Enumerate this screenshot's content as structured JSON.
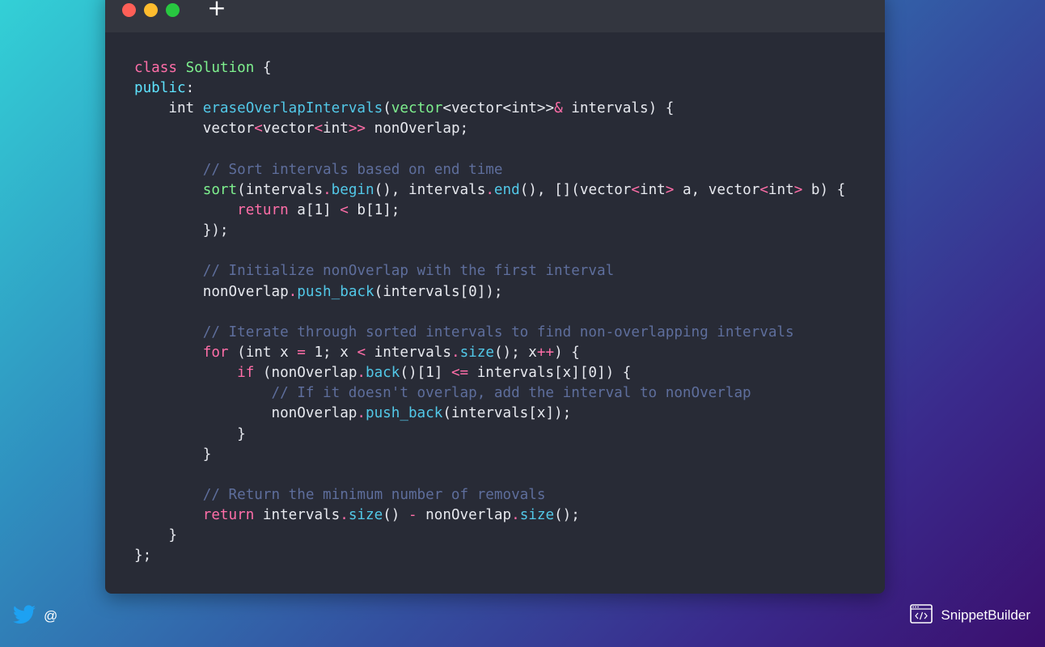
{
  "window": {
    "controls": {
      "close_color": "#fe5f57",
      "minimize_color": "#febc2e",
      "maximize_color": "#28c840"
    },
    "new_tab_symbol": "+"
  },
  "code": {
    "language": "cpp",
    "lines": [
      [
        {
          "t": "class",
          "c": "kw"
        },
        {
          "t": " ",
          "c": ""
        },
        {
          "t": "Solution",
          "c": "cls"
        },
        {
          "t": " {",
          "c": ""
        }
      ],
      [
        {
          "t": "public",
          "c": "ty"
        },
        {
          "t": ":",
          "c": ""
        }
      ],
      [
        {
          "t": "    int ",
          "c": ""
        },
        {
          "t": "eraseOverlapIntervals",
          "c": "fn"
        },
        {
          "t": "(",
          "c": ""
        },
        {
          "t": "vector",
          "c": "cls"
        },
        {
          "t": "<vector<int>>",
          "c": ""
        },
        {
          "t": "&",
          "c": "op"
        },
        {
          "t": " intervals) {",
          "c": ""
        }
      ],
      [
        {
          "t": "        vector",
          "c": ""
        },
        {
          "t": "<",
          "c": "op"
        },
        {
          "t": "vector",
          "c": ""
        },
        {
          "t": "<",
          "c": "op"
        },
        {
          "t": "int",
          "c": ""
        },
        {
          "t": ">>",
          "c": "op"
        },
        {
          "t": " nonOverlap;",
          "c": ""
        }
      ],
      [],
      [
        {
          "t": "        // Sort intervals based on end time",
          "c": "cm"
        }
      ],
      [
        {
          "t": "        ",
          "c": ""
        },
        {
          "t": "sort",
          "c": "cls"
        },
        {
          "t": "(intervals",
          "c": ""
        },
        {
          "t": ".",
          "c": "op"
        },
        {
          "t": "begin",
          "c": "fn"
        },
        {
          "t": "(), intervals",
          "c": ""
        },
        {
          "t": ".",
          "c": "op"
        },
        {
          "t": "end",
          "c": "fn"
        },
        {
          "t": "(), [](vector",
          "c": ""
        },
        {
          "t": "<",
          "c": "op"
        },
        {
          "t": "int",
          "c": ""
        },
        {
          "t": ">",
          "c": "op"
        },
        {
          "t": " a, vector",
          "c": ""
        },
        {
          "t": "<",
          "c": "op"
        },
        {
          "t": "int",
          "c": ""
        },
        {
          "t": ">",
          "c": "op"
        },
        {
          "t": " b) {",
          "c": ""
        }
      ],
      [
        {
          "t": "            ",
          "c": ""
        },
        {
          "t": "return",
          "c": "kw"
        },
        {
          "t": " a[1] ",
          "c": ""
        },
        {
          "t": "<",
          "c": "op"
        },
        {
          "t": " b[1];",
          "c": ""
        }
      ],
      [
        {
          "t": "        });",
          "c": ""
        }
      ],
      [],
      [
        {
          "t": "        // Initialize nonOverlap with the first interval",
          "c": "cm"
        }
      ],
      [
        {
          "t": "        nonOverlap",
          "c": ""
        },
        {
          "t": ".",
          "c": "op"
        },
        {
          "t": "push_back",
          "c": "fn"
        },
        {
          "t": "(intervals[0]);",
          "c": ""
        }
      ],
      [],
      [
        {
          "t": "        // Iterate through sorted intervals to find non-overlapping intervals",
          "c": "cm"
        }
      ],
      [
        {
          "t": "        ",
          "c": ""
        },
        {
          "t": "for",
          "c": "kw"
        },
        {
          "t": " (int x ",
          "c": ""
        },
        {
          "t": "=",
          "c": "op"
        },
        {
          "t": " 1; x ",
          "c": ""
        },
        {
          "t": "<",
          "c": "op"
        },
        {
          "t": " intervals",
          "c": ""
        },
        {
          "t": ".",
          "c": "op"
        },
        {
          "t": "size",
          "c": "fn"
        },
        {
          "t": "(); x",
          "c": ""
        },
        {
          "t": "++",
          "c": "op"
        },
        {
          "t": ") {",
          "c": ""
        }
      ],
      [
        {
          "t": "            ",
          "c": ""
        },
        {
          "t": "if",
          "c": "kw"
        },
        {
          "t": " (nonOverlap",
          "c": ""
        },
        {
          "t": ".",
          "c": "op"
        },
        {
          "t": "back",
          "c": "fn"
        },
        {
          "t": "()[1] ",
          "c": ""
        },
        {
          "t": "<=",
          "c": "op"
        },
        {
          "t": " intervals[x][0]) {",
          "c": ""
        }
      ],
      [
        {
          "t": "                // If it doesn't overlap, add the interval to nonOverlap",
          "c": "cm"
        }
      ],
      [
        {
          "t": "                nonOverlap",
          "c": ""
        },
        {
          "t": ".",
          "c": "op"
        },
        {
          "t": "push_back",
          "c": "fn"
        },
        {
          "t": "(intervals[x]);",
          "c": ""
        }
      ],
      [
        {
          "t": "            }",
          "c": ""
        }
      ],
      [
        {
          "t": "        }",
          "c": ""
        }
      ],
      [],
      [
        {
          "t": "        // Return the minimum number of removals",
          "c": "cm"
        }
      ],
      [
        {
          "t": "        ",
          "c": ""
        },
        {
          "t": "return",
          "c": "kw"
        },
        {
          "t": " intervals",
          "c": ""
        },
        {
          "t": ".",
          "c": "op"
        },
        {
          "t": "size",
          "c": "fn"
        },
        {
          "t": "() ",
          "c": ""
        },
        {
          "t": "-",
          "c": "op"
        },
        {
          "t": " nonOverlap",
          "c": ""
        },
        {
          "t": ".",
          "c": "op"
        },
        {
          "t": "size",
          "c": "fn"
        },
        {
          "t": "();",
          "c": ""
        }
      ],
      [
        {
          "t": "    }",
          "c": ""
        }
      ],
      [
        {
          "t": "};",
          "c": ""
        }
      ]
    ]
  },
  "footer": {
    "social_icon": "twitter-bird-icon",
    "handle": "@",
    "brand_icon": "code-window-icon",
    "brand_name": "SnippetBuilder"
  },
  "colors": {
    "editor_bg": "#282b36",
    "titlebar_bg": "#33363f",
    "twitter_blue": "#1da1f2"
  }
}
